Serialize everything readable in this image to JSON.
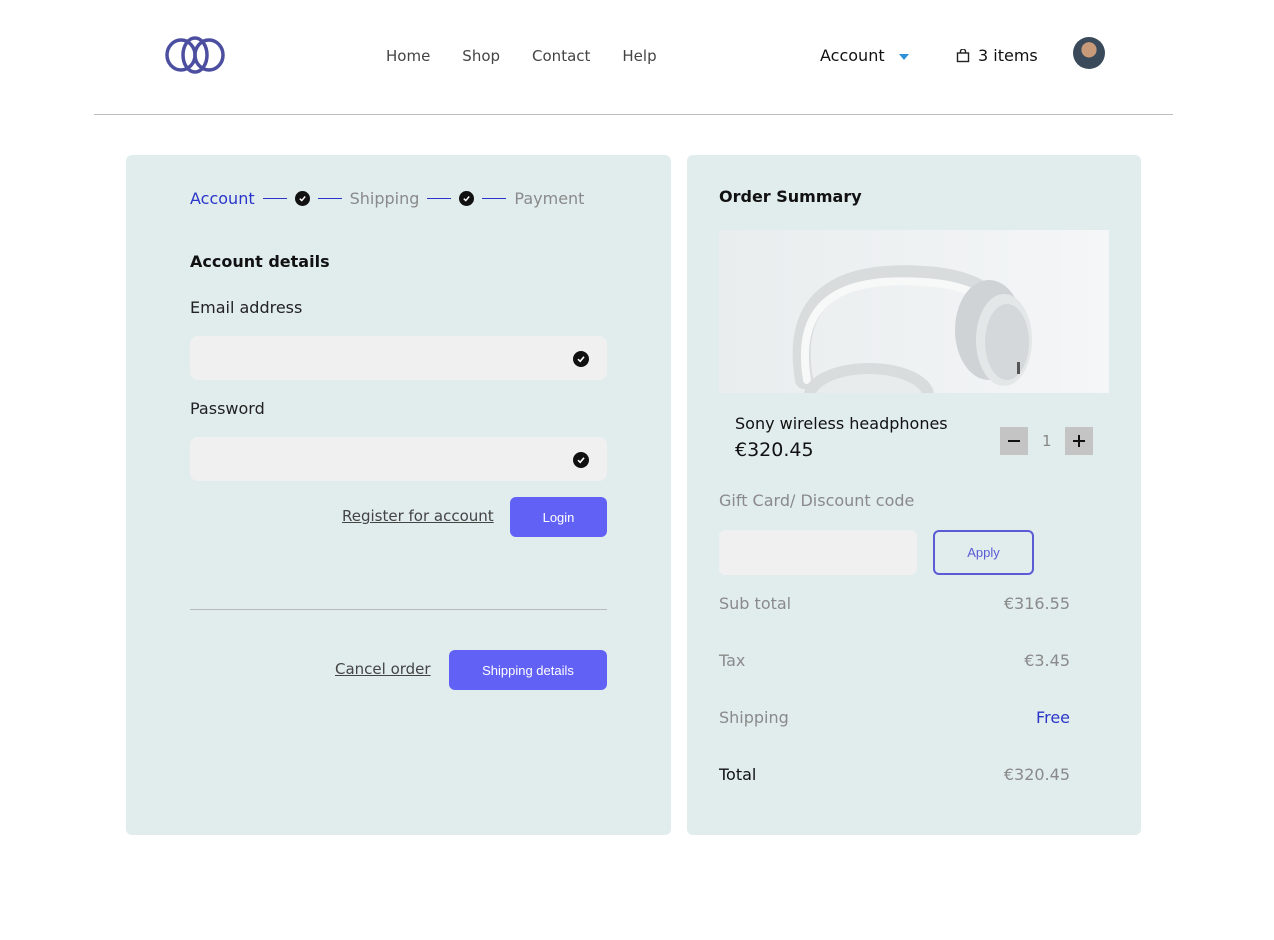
{
  "nav": {
    "links": [
      "Home",
      "Shop",
      "Contact",
      "Help"
    ],
    "account_label": "Account",
    "cart_label": "3 items"
  },
  "stepper": {
    "steps": [
      "Account",
      "Shipping",
      "Payment"
    ]
  },
  "account": {
    "section_title": "Account details",
    "email_label": "Email address",
    "password_label": "Password",
    "register_label": "Register for account",
    "login_label": "Login",
    "cancel_label": "Cancel order",
    "shipping_details_label": "Shipping details"
  },
  "summary": {
    "title": "Order Summary",
    "product_name": "Sony wireless headphones",
    "product_price": "€320.45",
    "quantity": "1",
    "gift_label": "Gift Card/ Discount code",
    "apply_label": "Apply",
    "rows": [
      {
        "label": "Sub total",
        "value": "€316.55"
      },
      {
        "label": "Tax",
        "value": "€3.45"
      },
      {
        "label": "Shipping",
        "value": "Free"
      },
      {
        "label": "Total",
        "value": "€320.45"
      }
    ]
  },
  "colors": {
    "accent": "#6161f5",
    "active_step": "#2a36c9",
    "panel_bg": "#e1eced"
  }
}
